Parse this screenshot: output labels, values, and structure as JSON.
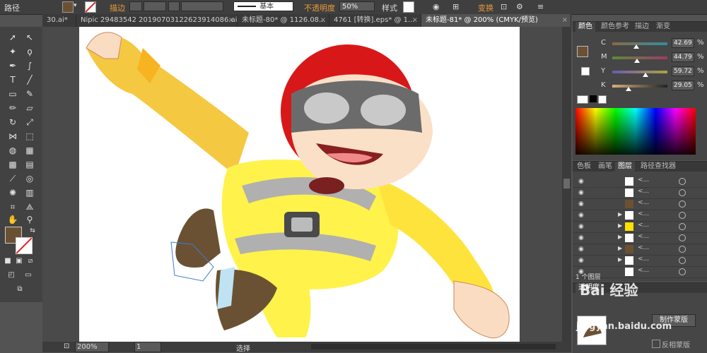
{
  "control_bar": {
    "object_type": "路径",
    "stroke_label": "描边",
    "brush_label": "基本",
    "opacity_label": "不透明度",
    "opacity_value": "50%",
    "style_label": "样式",
    "transform_label": "变换",
    "fill_color": "#6b5133"
  },
  "tabs": [
    {
      "label": "30.ai*"
    },
    {
      "label": "Nipic 29483542 20190703122623914086.ai*"
    },
    {
      "label": "未标题-80* @ 1126.08..."
    },
    {
      "label": "4761 [转换].eps* @ 1..."
    },
    {
      "label": "未标题-81* @ 200% (CMYK/预览)"
    }
  ],
  "status_bar": {
    "zoom": "200%",
    "page": "1",
    "tool_status": "选择"
  },
  "color_panel": {
    "tabs": [
      "颜色",
      "颜色参考",
      "描边",
      "渐变"
    ],
    "channels": [
      {
        "name": "C",
        "value": "42.69",
        "fraction": 0.43
      },
      {
        "name": "M",
        "value": "44.79",
        "fraction": 0.45
      },
      {
        "name": "Y",
        "value": "59.72",
        "fraction": 0.6
      },
      {
        "name": "K",
        "value": "29.05",
        "fraction": 0.29
      }
    ],
    "unit": "%",
    "current_color": "#6b5133"
  },
  "layers_panel": {
    "tabs": [
      "色板",
      "画笔",
      "图层",
      "路径查找器"
    ],
    "rows": [
      "<...",
      "<...",
      "<...",
      "<...",
      "<...",
      "<...",
      "<...",
      "<...",
      "<..."
    ],
    "footer": "1 个图层"
  },
  "transparency_panel": {
    "title": "透明度",
    "make_mask_label": "制作蒙版",
    "invert_mask_label": "反相蒙版"
  },
  "watermark": {
    "text": "Bai 经验",
    "sub": "jingyan.baidu.com"
  }
}
